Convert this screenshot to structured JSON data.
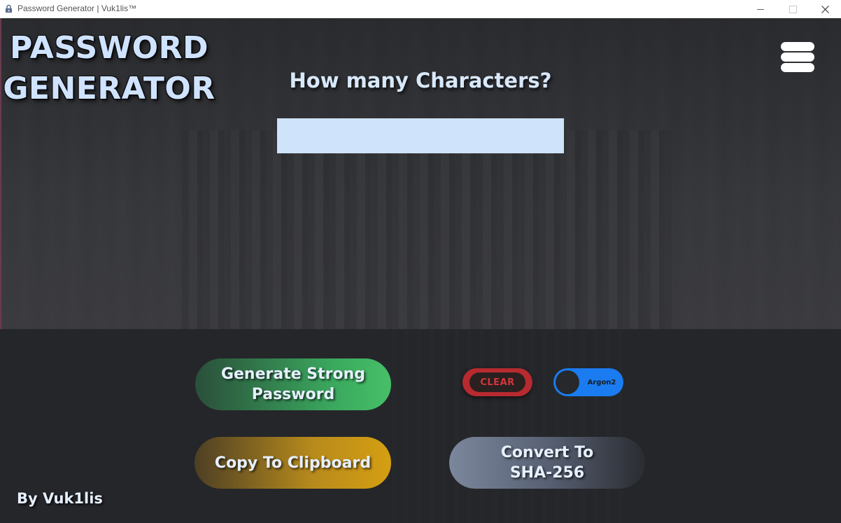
{
  "window": {
    "title": "Password Generator | Vuk1lis™",
    "controls": {
      "minimize": "",
      "maximize": "",
      "close": "✕"
    }
  },
  "header": {
    "title_line1": "PASSWORD",
    "title_line2": "GENERATOR",
    "menu_icon": "hamburger-menu-icon"
  },
  "main": {
    "question": "How many Characters?",
    "characters_input": {
      "value": "",
      "placeholder": ""
    }
  },
  "actions": {
    "generate_line1": "Generate Strong",
    "generate_line2": "Password",
    "clear": "CLEAR",
    "algorithm_toggle": "Argon2",
    "copy": "Copy To Clipboard",
    "sha_line1": "Convert To",
    "sha_line2": "SHA-256"
  },
  "footer": {
    "credit": "By Vuk1lis"
  },
  "colors": {
    "title": "#cfe3ff",
    "input_bg": "#cfe3fb",
    "generate": "#47bf68",
    "copy": "#d59f12",
    "clear": "#b72a30",
    "toggle": "#1a7cf0",
    "sha": "#7b879c"
  }
}
